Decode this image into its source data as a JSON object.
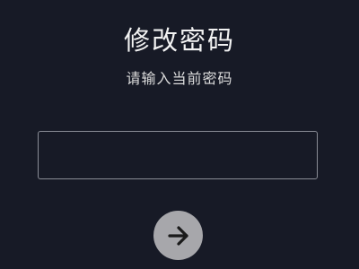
{
  "header": {
    "title": "修改密码",
    "subtitle": "请输入当前密码"
  },
  "form": {
    "password_value": "",
    "password_placeholder": ""
  },
  "submit": {
    "icon": "arrow-right-icon"
  },
  "colors": {
    "background": "#171a26",
    "text": "#f2f2f2",
    "field_border": "#8a8d96",
    "button_background": "#a7a7ab",
    "arrow": "#1a1a1a"
  }
}
